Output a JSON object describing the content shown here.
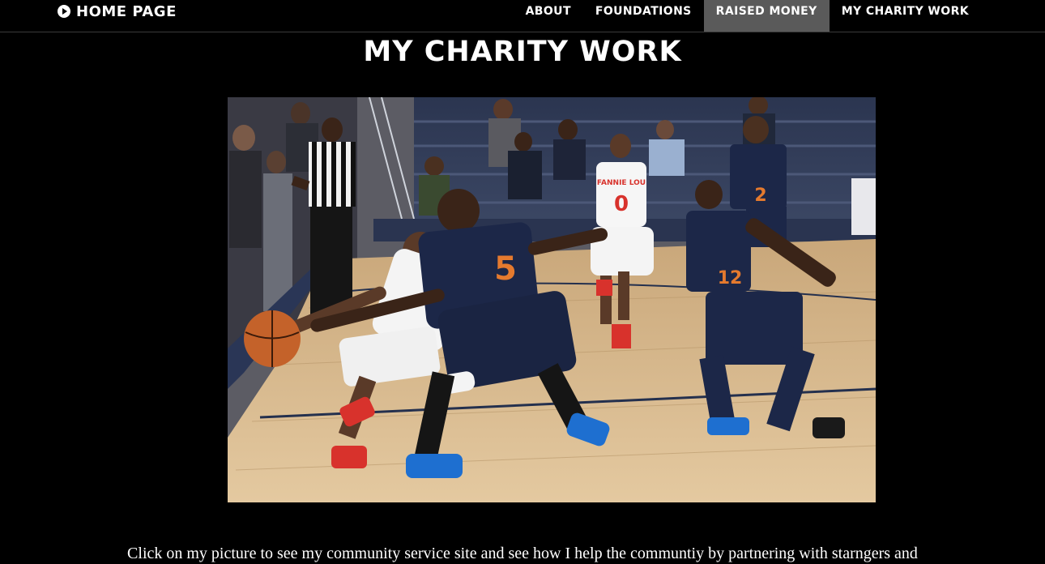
{
  "nav": {
    "brand": "HOME PAGE",
    "brand_icon": "play-circle-icon",
    "links": [
      {
        "label": "ABOUT",
        "active": false
      },
      {
        "label": "FOUNDATIONS",
        "active": false
      },
      {
        "label": "RAISED MONEY",
        "active": true
      },
      {
        "label": "MY CHARITY WORK",
        "active": false
      }
    ]
  },
  "page": {
    "title": "MY CHARITY WORK",
    "photo_alt": "Basketball game photo",
    "caption": "Click on my picture to see my community service site and see how I help the communtiy by partnering with starngers and"
  },
  "jerseys": {
    "white_team_text": "FANNIE LOU",
    "white_player_number": "0",
    "navy_player_left_number": "5",
    "navy_player_right_number": "12",
    "navy_player_back_number": "2"
  },
  "colors": {
    "background": "#000000",
    "text": "#ffffff",
    "nav_active": "#5a5a5a",
    "court": "#d9b98a",
    "navy": "#1c2748",
    "red": "#d8322c"
  }
}
